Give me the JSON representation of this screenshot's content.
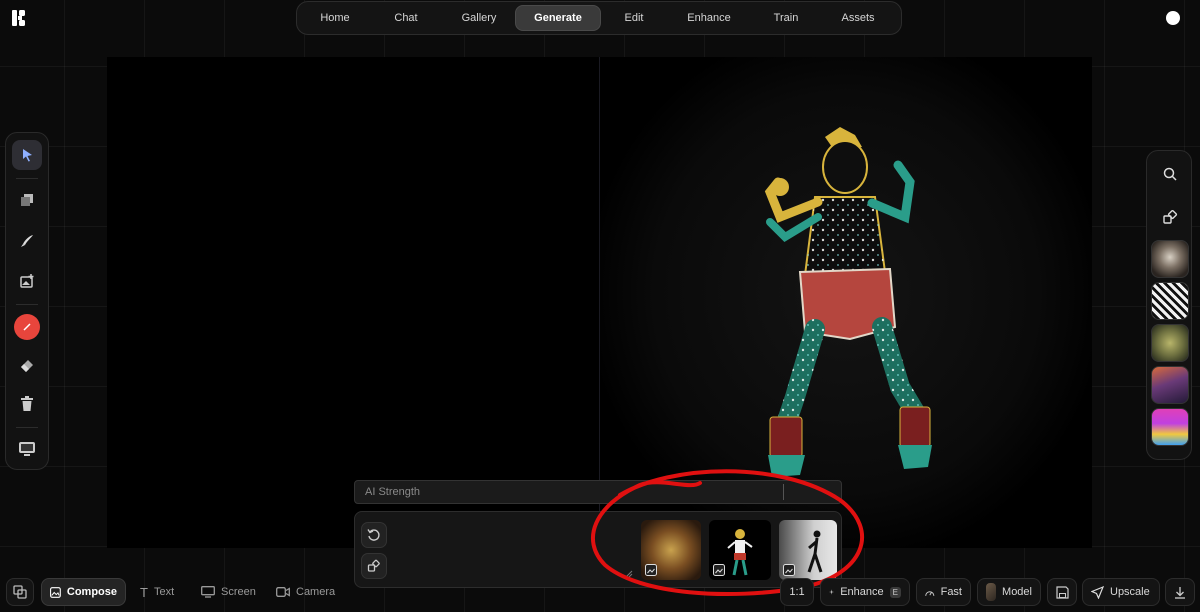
{
  "nav": {
    "tabs": [
      {
        "label": "Home"
      },
      {
        "label": "Chat"
      },
      {
        "label": "Gallery"
      },
      {
        "label": "Generate",
        "active": true
      },
      {
        "label": "Edit"
      },
      {
        "label": "Enhance"
      },
      {
        "label": "Train"
      },
      {
        "label": "Assets"
      }
    ]
  },
  "left_tools": [
    "select-icon",
    "layers-icon",
    "brush-icon",
    "image-add-icon",
    "color-swatch-icon",
    "eraser-icon",
    "trash-icon",
    "screen-capture-icon"
  ],
  "right_tools": [
    "search-icon",
    "shapes-icon"
  ],
  "strength": {
    "label": "AI Strength",
    "value": 0.88
  },
  "references": [
    {
      "name": "reference-image-creature"
    },
    {
      "name": "reference-image-dancer"
    },
    {
      "name": "reference-image-silhouette"
    }
  ],
  "bottombar": {
    "compose": "Compose",
    "text": "Text",
    "screen": "Screen",
    "camera": "Camera",
    "ratio": "1:1",
    "enhance": "Enhance",
    "enhance_key": "E",
    "fast": "Fast",
    "model": "Model",
    "upscale": "Upscale"
  },
  "colors": {
    "accent_red": "#e8453c",
    "annotation_red": "#e01010"
  }
}
